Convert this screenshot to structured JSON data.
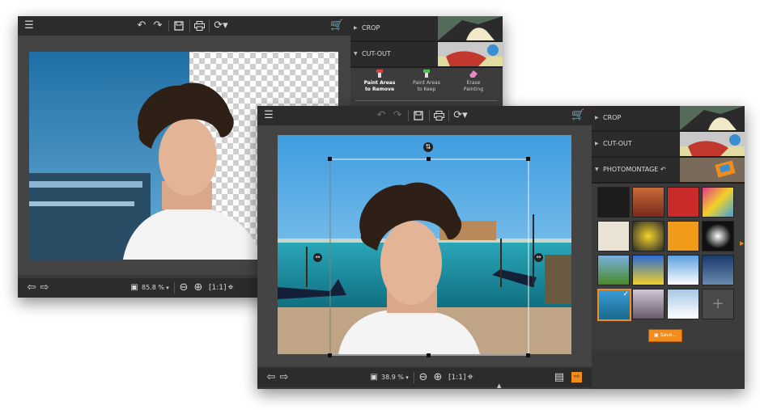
{
  "back_window": {
    "panel": {
      "sections": [
        {
          "label": "CROP"
        },
        {
          "label": "CUT-OUT"
        }
      ],
      "tools": [
        {
          "label": "Paint Areas to Remove",
          "line1": "Paint Areas",
          "line2": "to Remove"
        },
        {
          "label": "Paint Areas to Keep",
          "line1": "Paint Areas",
          "line2": "to Keep"
        },
        {
          "label": "Erase Painting",
          "line1": "Erase",
          "line2": "Painting"
        }
      ]
    },
    "zoom": "85.8 %"
  },
  "front_window": {
    "panel": {
      "sections": [
        {
          "label": "CROP"
        },
        {
          "label": "CUT-OUT"
        },
        {
          "label": "PHOTOMONTAGE"
        }
      ],
      "save_label": "Save..."
    },
    "zoom": "38.9 %",
    "accent": "#f28c1a"
  }
}
